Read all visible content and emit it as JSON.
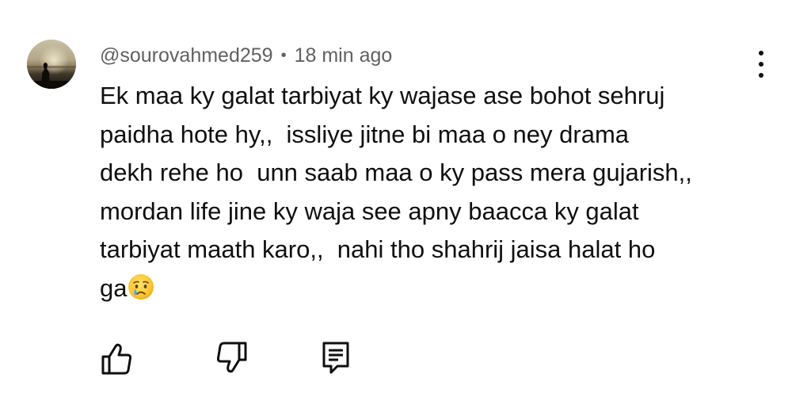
{
  "comment": {
    "author": "@sourovahmed259",
    "separator": "•",
    "timestamp": "18 min ago",
    "text_lines": [
      "Ek maa ky galat tarbiyat ky wajase ase bohot sehruj",
      "paidha hote hy,,  issliye jitne bi maa o ney drama",
      "dekh rehe ho  unn saab maa o ky pass mera gujarish,,",
      "mordan life jine ky waja see apny baacca ky galat",
      "tarbiyat maath karo,,  nahi tho shahrij jaisa halat ho",
      "ga"
    ],
    "trailing_emoji": "crying-face"
  },
  "icons": {
    "more": "vertical-ellipsis-icon",
    "like": "thumbs-up-icon",
    "dislike": "thumbs-down-icon",
    "reply": "reply-comment-icon"
  },
  "colors": {
    "text": "#0f0f0f",
    "meta": "#606060",
    "icon": "#0f0f0f",
    "background": "#ffffff"
  }
}
